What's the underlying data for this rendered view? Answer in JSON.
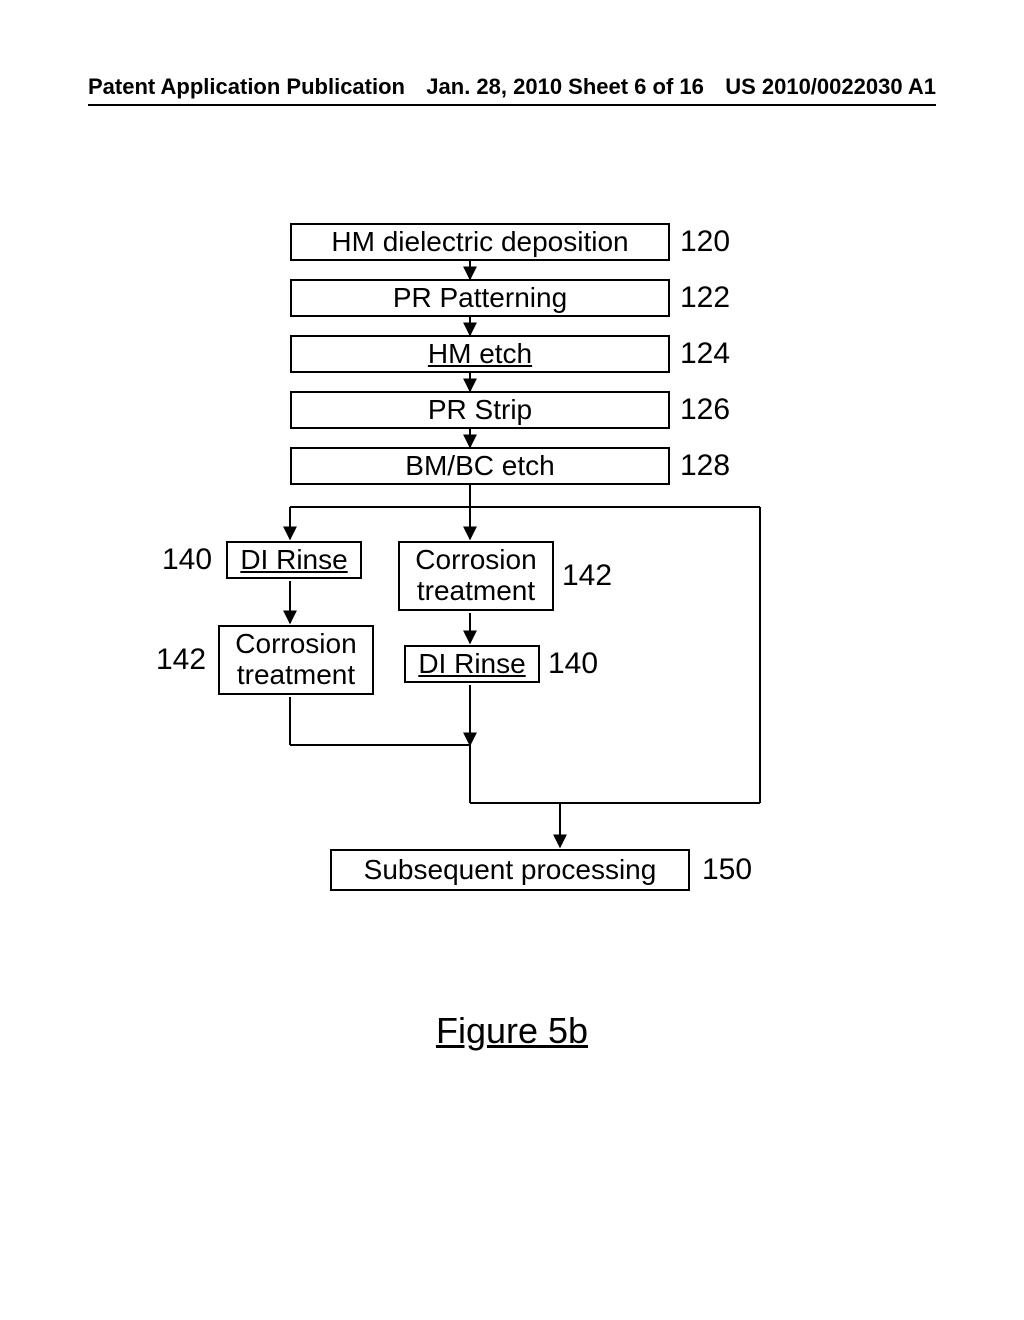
{
  "header": {
    "left": "Patent Application Publication",
    "mid": "Jan. 28, 2010  Sheet 6 of 16",
    "right": "US 2010/0022030 A1"
  },
  "flow": {
    "step120": {
      "label": "HM dielectric deposition",
      "ref": "120"
    },
    "step122": {
      "label": "PR Patterning",
      "ref": "122"
    },
    "step124": {
      "label": "HM etch",
      "ref": "124"
    },
    "step126": {
      "label": "PR Strip",
      "ref": "126"
    },
    "step128": {
      "label": "BM/BC etch",
      "ref": "128"
    },
    "left140": {
      "label": "DI Rinse",
      "ref": "140"
    },
    "left142": {
      "label": "Corrosion treatment",
      "ref": "142"
    },
    "right142": {
      "label": "Corrosion treatment",
      "ref": "142"
    },
    "right140": {
      "label": "DI Rinse",
      "ref": "140"
    },
    "step150": {
      "label": "Subsequent processing",
      "ref": "150"
    }
  },
  "figure_caption": "Figure 5b"
}
